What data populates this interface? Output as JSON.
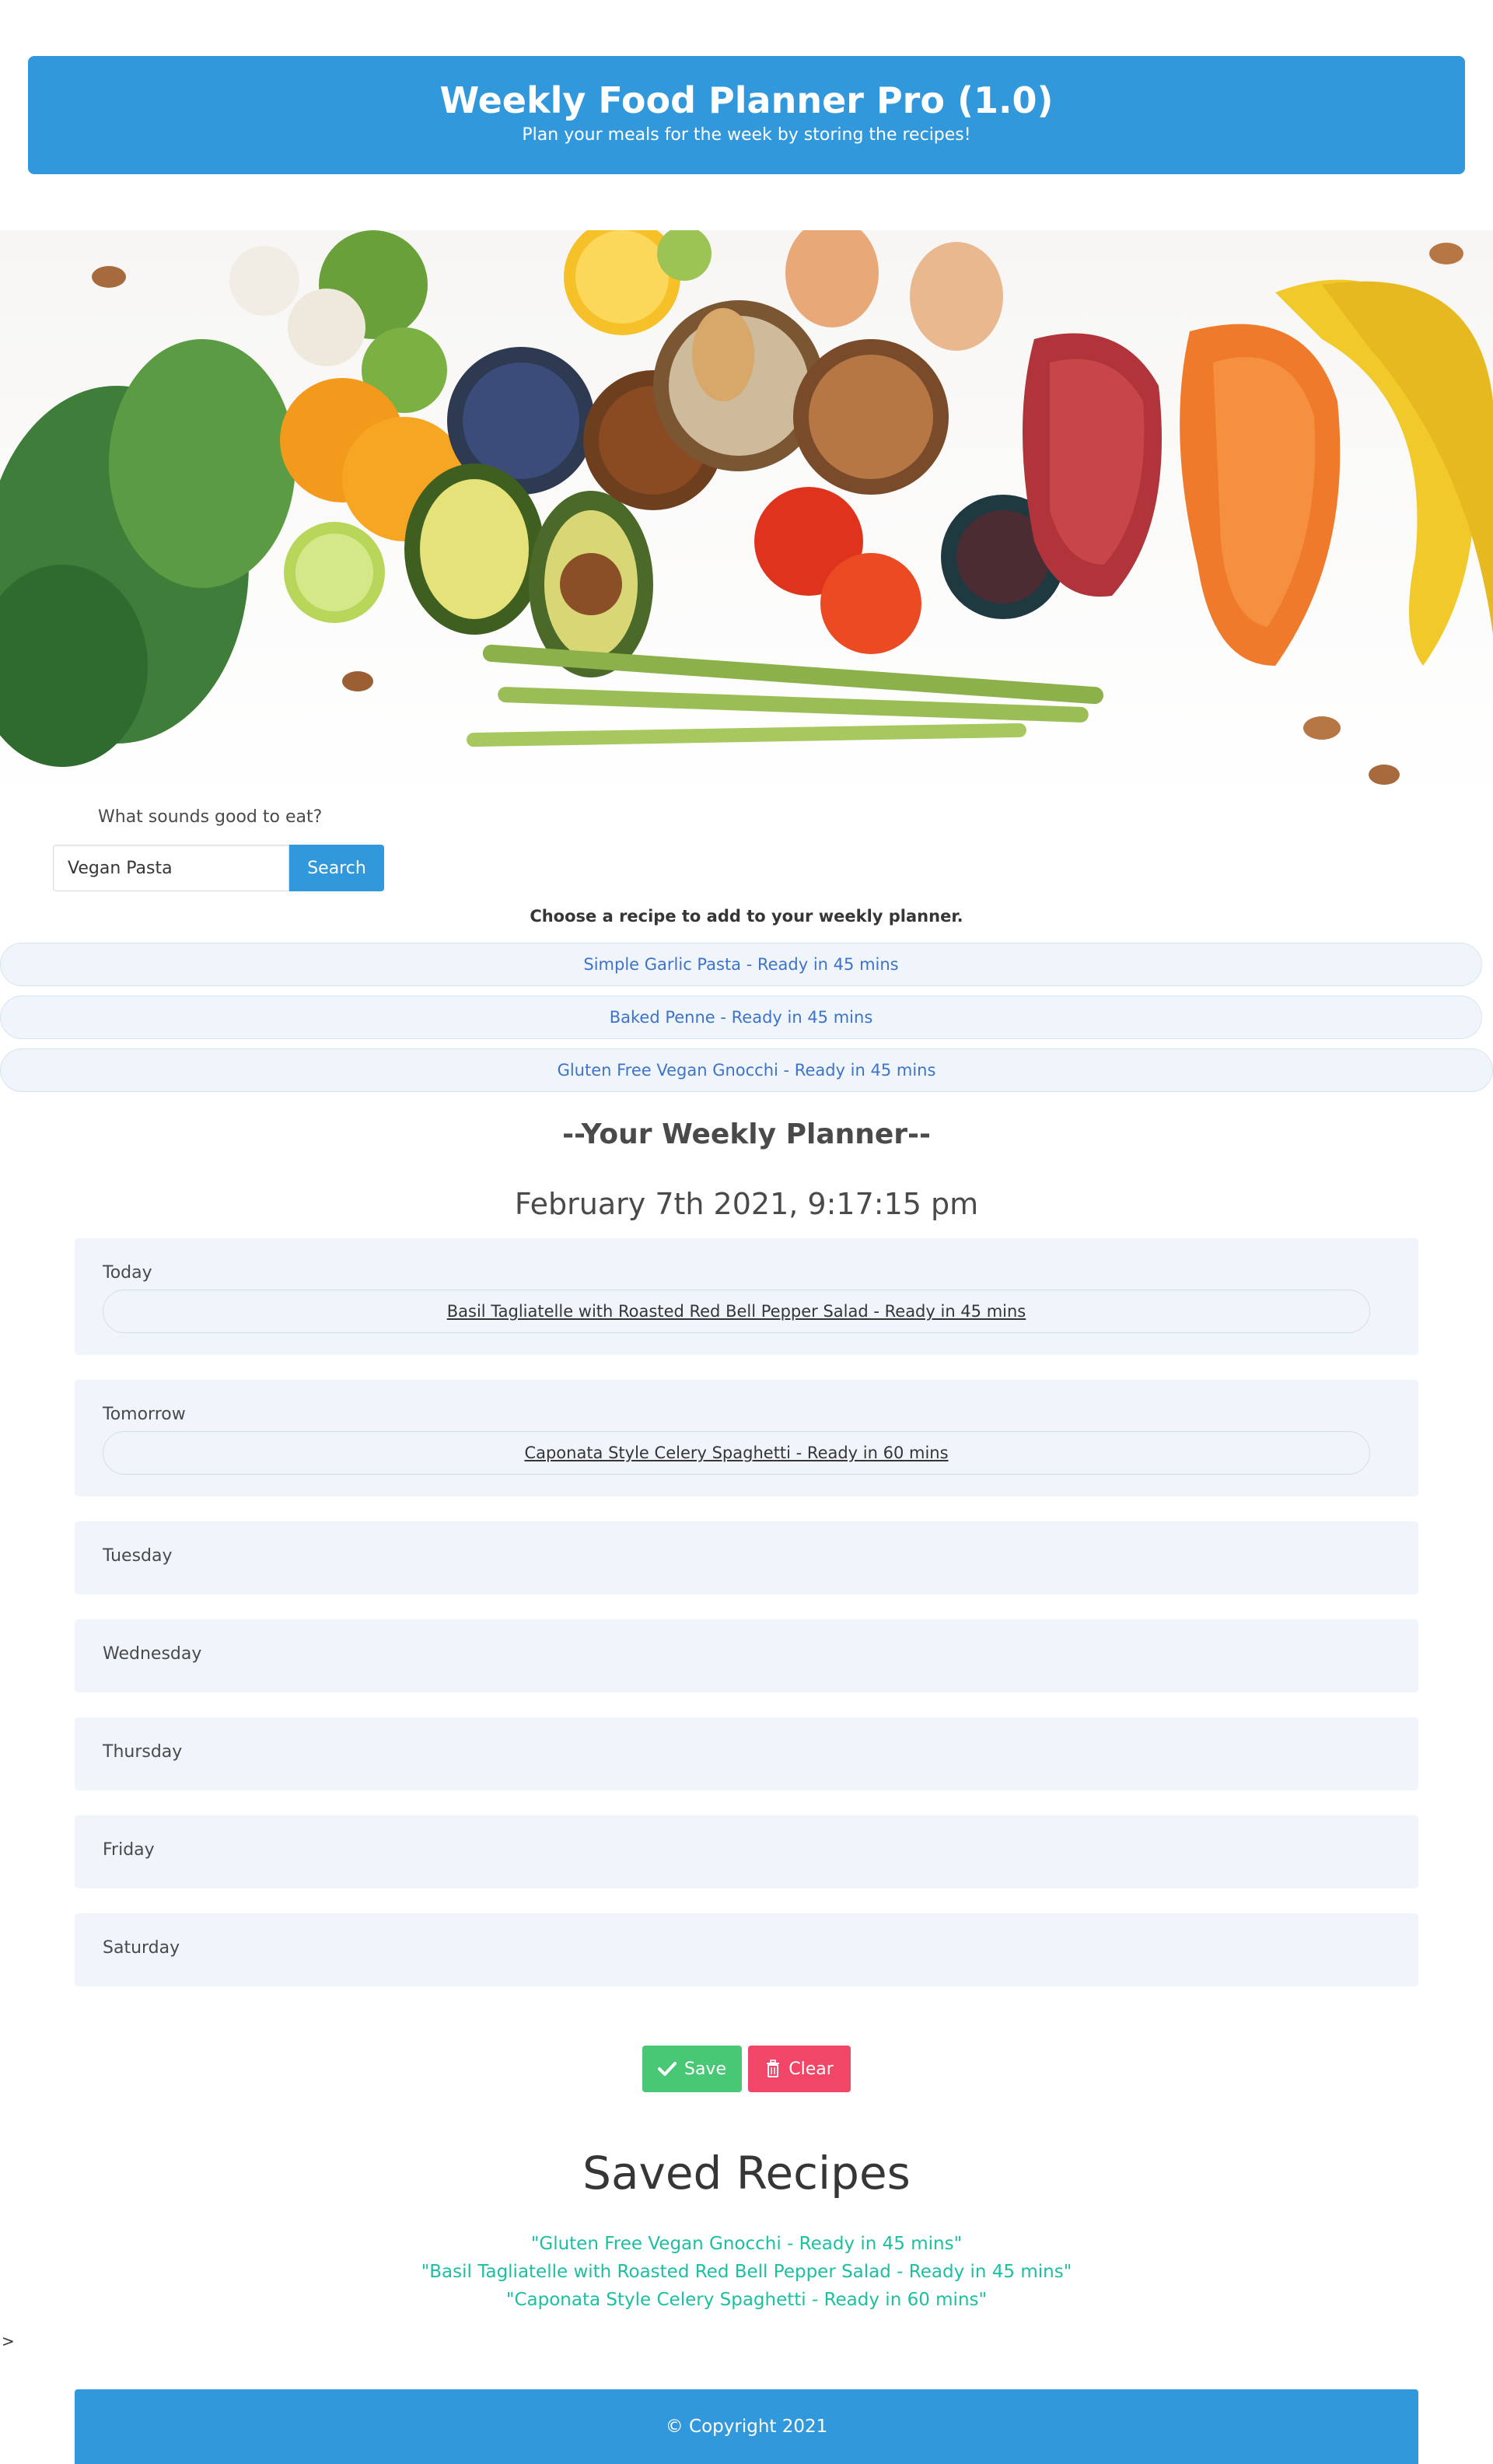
{
  "header": {
    "title": "Weekly Food Planner Pro (1.0)",
    "subtitle": "Plan your meals for the week by storing the recipes!"
  },
  "search": {
    "prompt": "What sounds good to eat?",
    "value": "Vegan Pasta",
    "button_label": "Search"
  },
  "results": {
    "instruction": "Choose a recipe to add to your weekly planner.",
    "items": [
      "Simple Garlic Pasta - Ready in 45 mins",
      "Baked Penne - Ready in 45 mins",
      "Gluten Free Vegan Gnocchi - Ready in 45 mins"
    ]
  },
  "planner": {
    "heading": "--Your Weekly Planner--",
    "date": "February 7th 2021, 9:17:15 pm",
    "days": [
      {
        "label": "Today",
        "recipe": "Basil Tagliatelle with Roasted Red Bell Pepper Salad - Ready in 45 mins"
      },
      {
        "label": "Tomorrow",
        "recipe": "Caponata Style Celery Spaghetti - Ready in 60 mins"
      },
      {
        "label": "Tuesday",
        "recipe": ""
      },
      {
        "label": "Wednesday",
        "recipe": ""
      },
      {
        "label": "Thursday",
        "recipe": ""
      },
      {
        "label": "Friday",
        "recipe": ""
      },
      {
        "label": "Saturday",
        "recipe": ""
      }
    ],
    "save_label": "Save",
    "clear_label": "Clear"
  },
  "saved": {
    "heading": "Saved Recipes",
    "items": [
      "\"Gluten Free Vegan Gnocchi - Ready in 45 mins\"",
      "\"Basil Tagliatelle with Roasted Red Bell Pepper Salad - Ready in 45 mins\"",
      "\"Caponata Style Celery Spaghetti - Ready in 60 mins\""
    ]
  },
  "stray_text": ">",
  "footer": {
    "copyright": "© Copyright 2021"
  },
  "colors": {
    "primary": "#3298dc",
    "success": "#48c774",
    "danger": "#f14668",
    "saved_text": "#1cbfa0",
    "panel_bg": "#eff5fb"
  },
  "icons": {
    "save": "check-icon",
    "clear": "trash-icon"
  }
}
